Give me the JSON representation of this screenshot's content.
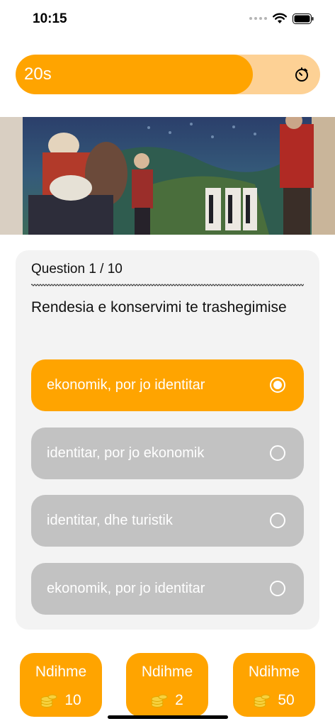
{
  "status_bar": {
    "time": "10:15",
    "icons": [
      "cellular-signal-icon",
      "wifi-icon",
      "battery-icon"
    ]
  },
  "timer": {
    "label": "20s",
    "remaining_fraction": 0.78,
    "icon": "stopwatch-icon",
    "fill_color": "#ffa400",
    "track_color": "#fdd195"
  },
  "hero_image": {
    "description_icon": "painting-image"
  },
  "question": {
    "counter": "Question 1 / 10",
    "text": "Rendesia e konservimi te trashegimise",
    "answers": [
      {
        "label": "ekonomik, por jo identitar",
        "selected": true
      },
      {
        "label": "identitar, por jo ekonomik",
        "selected": false
      },
      {
        "label": "identitar, dhe turistik",
        "selected": false
      },
      {
        "label": "ekonomik, por jo identitar",
        "selected": false
      }
    ]
  },
  "help_buttons": [
    {
      "label": "Ndihme",
      "count": "10",
      "icon": "coins-icon"
    },
    {
      "label": "Ndihme",
      "count": "2",
      "icon": "coins-icon"
    },
    {
      "label": "Ndihme",
      "count": "50",
      "icon": "coins-icon"
    }
  ],
  "colors": {
    "accent": "#ffa400",
    "answer_default": "#c2c2c2",
    "card_bg": "#f3f3f3"
  }
}
